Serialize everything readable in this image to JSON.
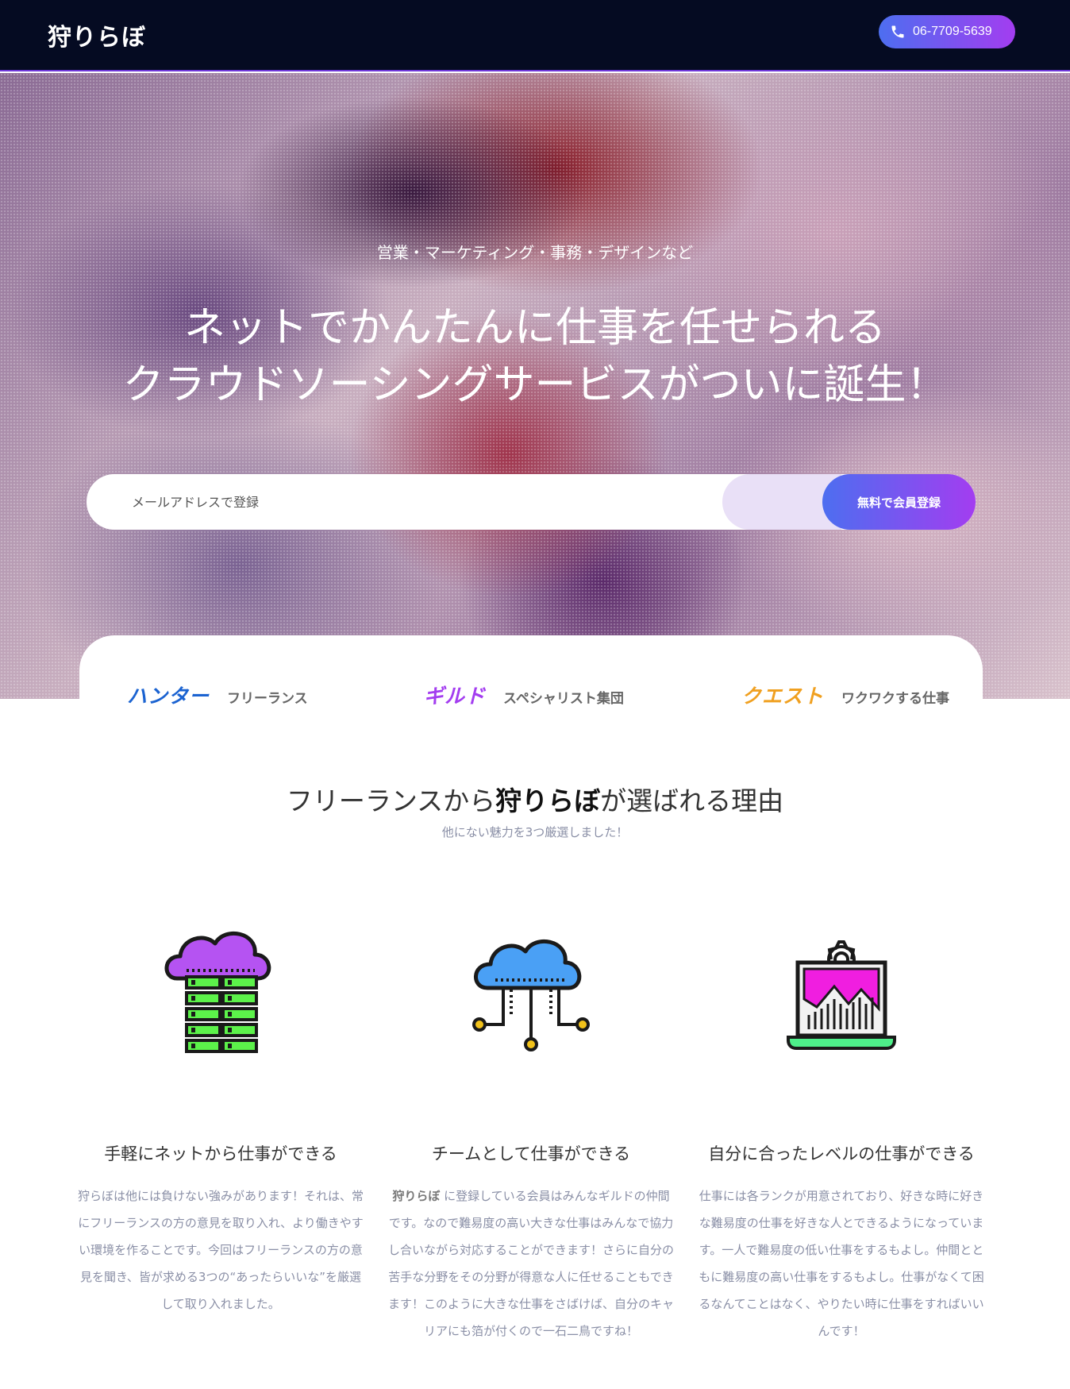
{
  "header": {
    "logo": "狩りらぼ",
    "phone": "06-7709-5639"
  },
  "hero": {
    "subtitle": "営業・マーケティング・事務・デザインなど",
    "title_line1": "ネットでかんたんに仕事を任せられる",
    "title_line2": "クラウドソーシングサービスがついに誕生！",
    "email_placeholder": "メールアドレスで登録",
    "signup_label": "無料で会員登録"
  },
  "categories": [
    {
      "name": "ハンター",
      "desc": "フリーランス",
      "color": "#1b63d1"
    },
    {
      "name": "ギルド",
      "desc": "スペシャリスト集団",
      "color": "#a33df0"
    },
    {
      "name": "クエスト",
      "desc": "ワクワクする仕事",
      "color": "#f0a020"
    }
  ],
  "reasons": {
    "title_pre": "フリーランスから",
    "title_brand": "狩りらぼ",
    "title_post": "が選ばれる理由",
    "subtitle": "他にない魅力を3つ厳選しました！",
    "features": [
      {
        "icon": "cloud-server-icon",
        "title": "手軽にネットから仕事ができる",
        "body": "狩らぼは他には負けない強みがあります！それは、常にフリーランスの方の意見を取り入れ、より働きやすい環境を作ることです。今回はフリーランスの方の意見を聞き、皆が求める3つの“あったらいいな”を厳選して取り入れました。"
      },
      {
        "icon": "cloud-network-icon",
        "title": "チームとして仕事ができる",
        "body_brand": "狩りらぼ",
        "body": " に登録している会員はみんなギルドの仲間です。なので難易度の高い大きな仕事はみんなで協力し合いながら対応することができます！さらに自分の苦手な分野をその分野が得意な人に任せることもできます！このように大きな仕事をさばけば、自分のキャリアにも箔が付くので一石二鳥ですね！"
      },
      {
        "icon": "laptop-chart-gear-icon",
        "title": "自分に合ったレベルの仕事ができる",
        "body": "仕事には各ランクが用意されており、好きな時に好きな難易度の仕事を好きな人とできるようになっています。一人で難易度の低い仕事をするもよし。仲間とともに難易度の高い仕事をするもよし。仕事がなくて困るなんてことはなく、やりたい時に仕事をすればいいんです！"
      }
    ]
  }
}
